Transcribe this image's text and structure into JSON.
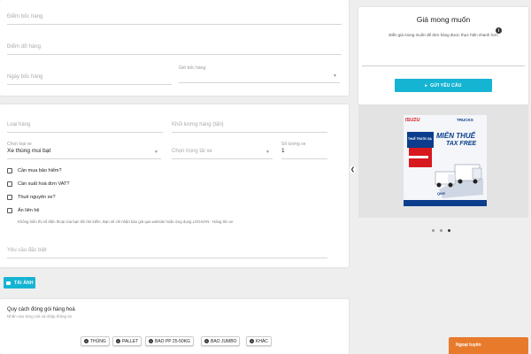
{
  "address_card": {
    "pickup_placeholder": "Điểm bốc hàng",
    "dropoff_placeholder": "Điểm dỡ hàng",
    "date_placeholder": "Ngày bốc hàng",
    "time_label": "Giờ bốc hàng"
  },
  "cargo_card": {
    "goods_type_placeholder": "Loại hàng",
    "weight_placeholder": "Khối lượng hàng (tấn)",
    "vehicle_type_label": "Chọn loại xe",
    "vehicle_type_value": "Xe thùng mui bạt",
    "tonnage_placeholder": "Chọn trọng tải xe",
    "vehicle_count_label": "Số lượng xe",
    "vehicle_count_value": "1",
    "checkboxes": [
      {
        "label": "Cần mua bảo hiểm?"
      },
      {
        "label": "Cần xuất hoá đơn VAT?"
      },
      {
        "label": "Thuê nguyên xe?"
      },
      {
        "label": "Ẩn liên hệ"
      }
    ],
    "hide_contact_note": "Không hiển thị số điện thoại của bạn khi tìm kiếm. Bạn sẽ chỉ nhận báo giá qua website hoặc ứng dụng LOGIVAN - Hàng tìm xe",
    "special_request_placeholder": "Yêu cầu đặc biệt"
  },
  "upload_button": {
    "label": "TẢI ẢNH"
  },
  "packaging_card": {
    "title": "Quy cách đóng gói hàng hoá",
    "subtitle": "Nhấn vào từng nút và nhập thông tin",
    "chips": [
      {
        "label": "THÙNG"
      },
      {
        "label": "PALLET"
      },
      {
        "label": "BAO PP 25-50KG"
      },
      {
        "label": "BAO JUMBO"
      },
      {
        "label": "KHÁC"
      }
    ]
  },
  "price_card": {
    "title": "Giá mong muốn",
    "description": "Điền giá mong muốn để đơn hàng được thực hiện nhanh hơn",
    "info_icon": "info-icon",
    "submit_label": "GỬI YÊU CẦU"
  },
  "ad_banner": {
    "brand_left": "ISUZU",
    "brand_right": "TRUCKS",
    "headline_1": "MIỄN THUẾ",
    "headline_2": "TAX FREE",
    "sub_headline": "THUẾ TRƯỚC BẠ",
    "model_text": "QKR",
    "slide_count": 3,
    "active_slide": 3,
    "colors": {
      "red": "#d7191f",
      "blue": "#0b3d8c"
    }
  },
  "foreign_button": {
    "label": "Ngoại tuyến"
  },
  "colors": {
    "accent": "#16b4d3",
    "orange": "#e87a2c"
  }
}
